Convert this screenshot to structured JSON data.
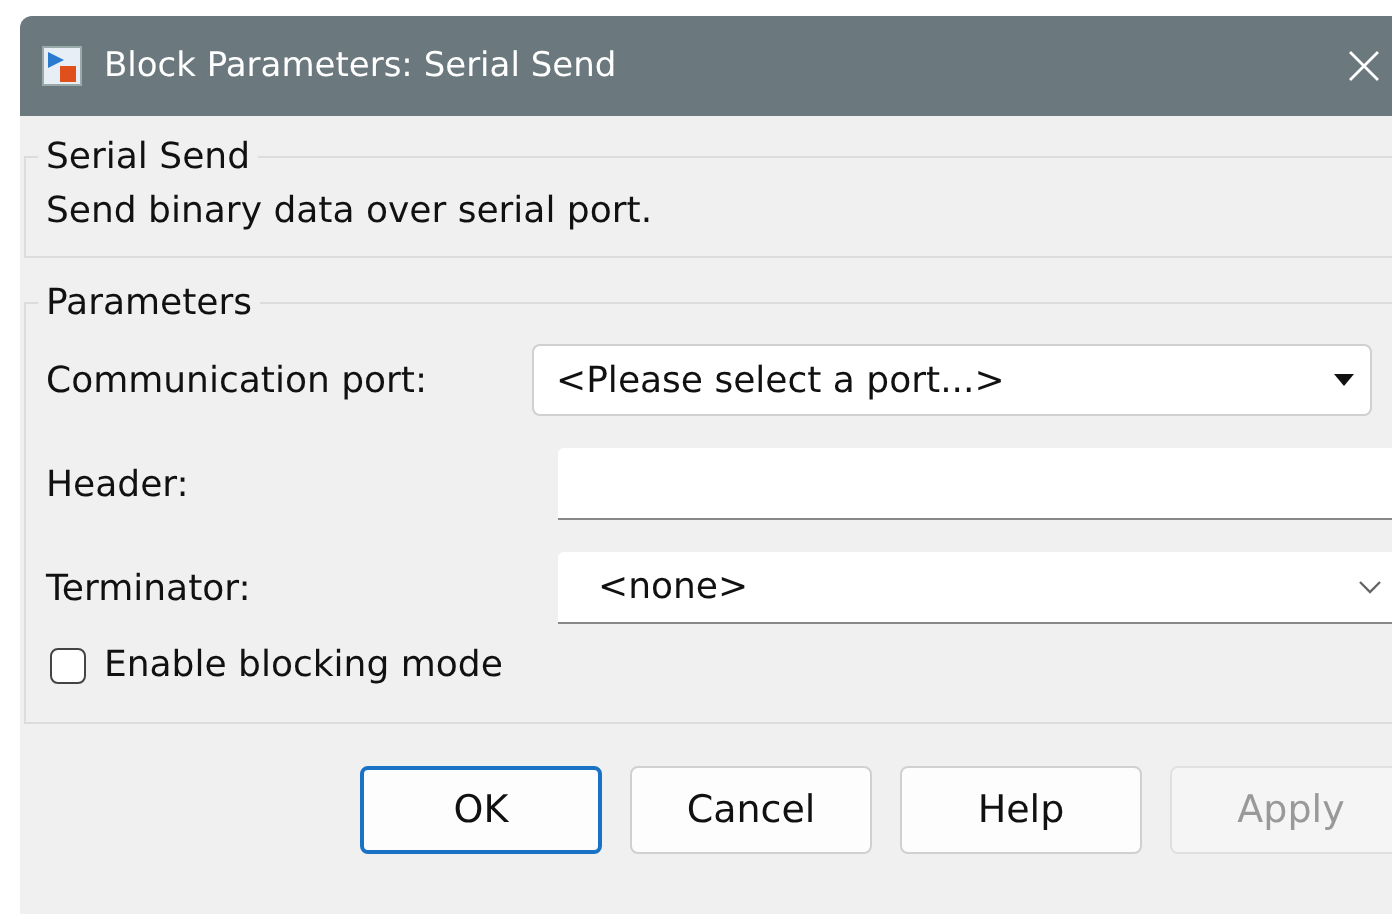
{
  "window": {
    "title": "Block Parameters: Serial Send"
  },
  "description_group": {
    "title": "Serial Send",
    "text": "Send binary data over serial port."
  },
  "parameters": {
    "title": "Parameters",
    "fields": [
      {
        "kind": "dropdown",
        "label": "Communication port:",
        "value": "<Please select a port...>"
      },
      {
        "kind": "text",
        "label": "Header:"
      },
      {
        "kind": "combo",
        "label": "Terminator:",
        "value": "<none>"
      }
    ],
    "checkbox": {
      "label": "Enable blocking mode",
      "checked": false
    }
  },
  "buttons": [
    {
      "label": "OK",
      "default": true,
      "disabled": false
    },
    {
      "label": "Cancel",
      "default": false,
      "disabled": false
    },
    {
      "label": "Help",
      "default": false,
      "disabled": false
    },
    {
      "label": "Apply",
      "default": false,
      "disabled": true
    }
  ]
}
